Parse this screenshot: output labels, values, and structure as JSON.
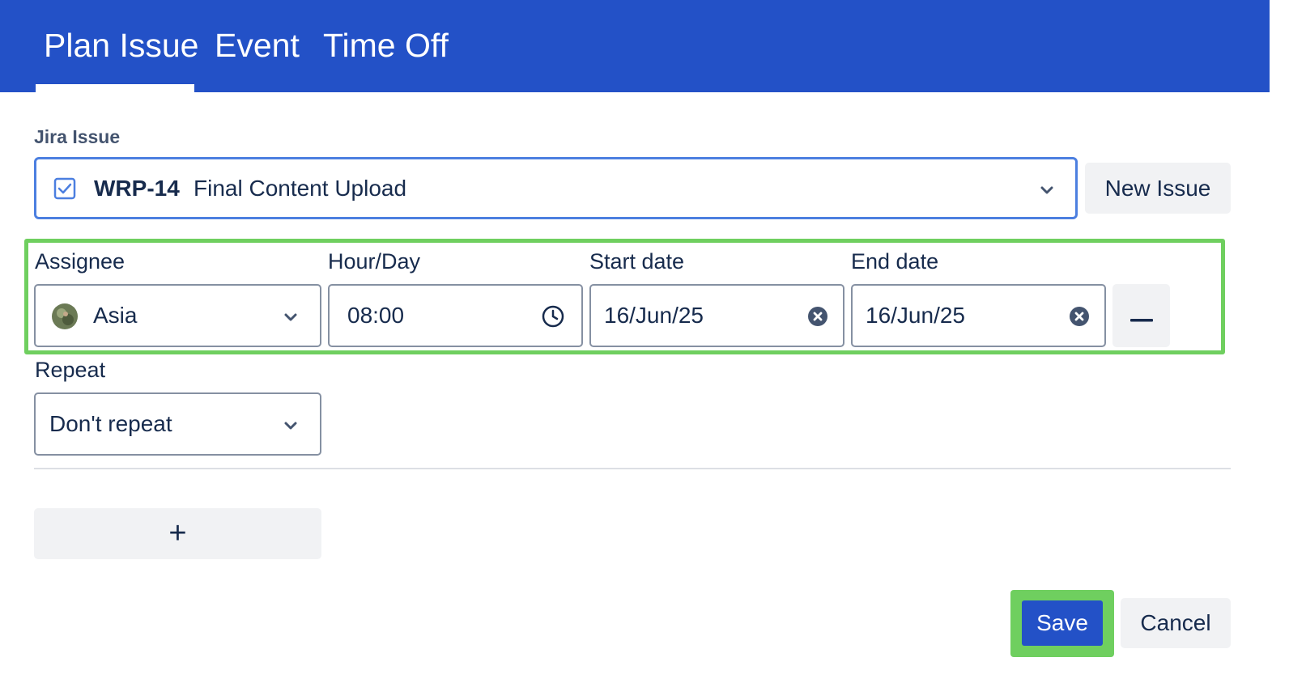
{
  "tabs": [
    {
      "label": "Plan Issue",
      "active": true
    },
    {
      "label": "Event",
      "active": false
    },
    {
      "label": "Time Off",
      "active": false
    }
  ],
  "jira_issue": {
    "label": "Jira Issue",
    "key": "WRP-14",
    "summary": "Final Content Upload",
    "new_issue_label": "New Issue"
  },
  "assignment": {
    "assignee_label": "Assignee",
    "assignee_value": "Asia",
    "hour_label": "Hour/Day",
    "hour_value": "08:00",
    "start_label": "Start date",
    "start_value": "16/Jun/25",
    "end_label": "End date",
    "end_value": "16/Jun/25"
  },
  "repeat": {
    "label": "Repeat",
    "value": "Don't repeat"
  },
  "actions": {
    "add_label": "+",
    "save_label": "Save",
    "cancel_label": "Cancel"
  },
  "colors": {
    "header": "#2351c7",
    "highlight": "#6fcf5f",
    "focus_border": "#4c7fe0"
  },
  "icons": {
    "issue_type": "checkbox-icon",
    "dropdown": "chevron-down-icon",
    "time": "clock-icon",
    "clear": "clear-icon",
    "remove_row": "minus-icon",
    "add_row": "plus-icon"
  }
}
